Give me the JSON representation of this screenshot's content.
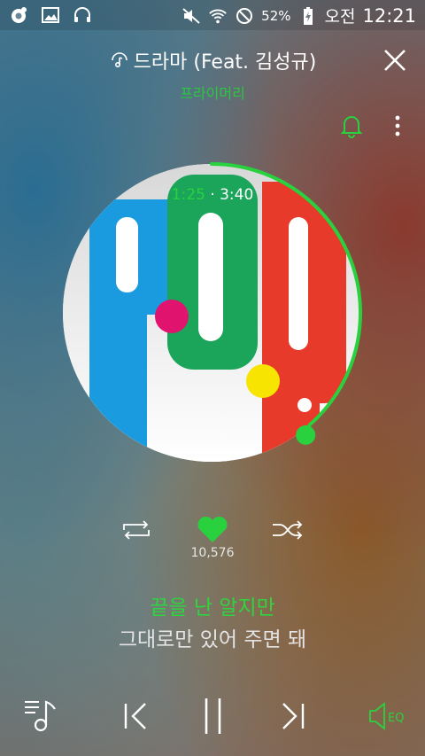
{
  "status_bar": {
    "battery_percent": "52%",
    "ampm": "오전",
    "time": "12:21",
    "icons": [
      "app-notification-icon",
      "gallery-icon",
      "headphones-icon",
      "mute-icon",
      "wifi-icon",
      "do-not-disturb-icon",
      "battery-charging-icon"
    ]
  },
  "track": {
    "title": "드라마 (Feat. 김성규)",
    "artist": "프라이머리"
  },
  "playback": {
    "elapsed": "1:25",
    "separator": "·",
    "duration": "3:40",
    "progress_fraction": 0.386
  },
  "album_art": {
    "text": "P.O.P.",
    "colors": {
      "blue": "#1a9be0",
      "green": "#1ba55a",
      "red": "#e73a2a",
      "magenta": "#e0136e",
      "yellow": "#f7e400"
    }
  },
  "actions": {
    "like_count": "10,576",
    "liked": true
  },
  "lyrics": {
    "current": "끝을 난 알지만",
    "next": "그대로만 있어 주면 돼"
  },
  "bottom_controls": {
    "eq_label": "EQ"
  },
  "colors": {
    "accent": "#2ad13e",
    "text": "#ffffff"
  }
}
